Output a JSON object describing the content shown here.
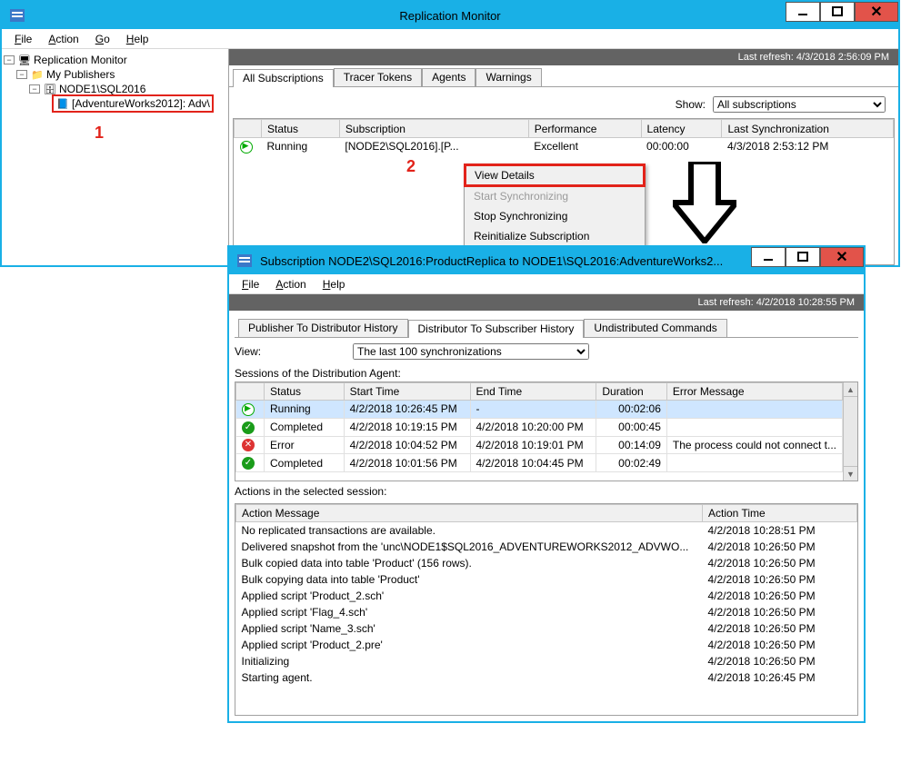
{
  "outer": {
    "title": "Replication Monitor",
    "menu": [
      "File",
      "Action",
      "Go",
      "Help"
    ],
    "last_refresh": "Last refresh: 4/3/2018 2:56:09 PM",
    "tree": {
      "root": "Replication Monitor",
      "publishers": "My Publishers",
      "node": "NODE1\\SQL2016",
      "pub": "[AdventureWorks2012]: Adv\\"
    },
    "tabs": [
      "All Subscriptions",
      "Tracer Tokens",
      "Agents",
      "Warnings"
    ],
    "show_label": "Show:",
    "show_value": "All subscriptions",
    "grid": {
      "headers": [
        "Status",
        "Subscription",
        "Performance",
        "Latency",
        "Last Synchronization"
      ],
      "row": {
        "status": "Running",
        "subscription": "[NODE2\\SQL2016].[P...",
        "performance": "Excellent",
        "latency": "00:00:00",
        "last_sync": "4/3/2018 2:53:12 PM"
      }
    },
    "ctx": {
      "view_details": "View Details",
      "start": "Start Synchronizing",
      "stop": "Stop Synchronizing",
      "reinit": "Reinitialize Subscription"
    },
    "ann1": "1",
    "ann2": "2"
  },
  "inner": {
    "title": "Subscription NODE2\\SQL2016:ProductReplica to NODE1\\SQL2016:AdventureWorks2...",
    "menu": [
      "File",
      "Action",
      "Help"
    ],
    "last_refresh": "Last refresh: 4/2/2018 10:28:55 PM",
    "tabs": [
      "Publisher To Distributor History",
      "Distributor To Subscriber History",
      "Undistributed Commands"
    ],
    "view_label": "View:",
    "view_value": "The last 100 synchronizations",
    "sessions_label": "Sessions of the Distribution Agent:",
    "sessions_headers": [
      "Status",
      "Start Time",
      "End Time",
      "Duration",
      "Error Message"
    ],
    "sessions": [
      {
        "icon": "run",
        "status": "Running",
        "start": "4/2/2018 10:26:45 PM",
        "end": "-",
        "duration": "00:02:06",
        "err": ""
      },
      {
        "icon": "ok",
        "status": "Completed",
        "start": "4/2/2018 10:19:15 PM",
        "end": "4/2/2018 10:20:00 PM",
        "duration": "00:00:45",
        "err": ""
      },
      {
        "icon": "err",
        "status": "Error",
        "start": "4/2/2018 10:04:52 PM",
        "end": "4/2/2018 10:19:01 PM",
        "duration": "00:14:09",
        "err": "The process could not connect t..."
      },
      {
        "icon": "ok",
        "status": "Completed",
        "start": "4/2/2018 10:01:56 PM",
        "end": "4/2/2018 10:04:45 PM",
        "duration": "00:02:49",
        "err": ""
      }
    ],
    "actions_label": "Actions in the selected session:",
    "actions_headers": [
      "Action Message",
      "Action Time"
    ],
    "actions": [
      {
        "msg": "No replicated transactions are available.",
        "time": "4/2/2018 10:28:51 PM"
      },
      {
        "msg": "Delivered snapshot from the 'unc\\NODE1$SQL2016_ADVENTUREWORKS2012_ADVWO...",
        "time": "4/2/2018 10:26:50 PM"
      },
      {
        "msg": "Bulk copied data into table 'Product' (156 rows).",
        "time": "4/2/2018 10:26:50 PM"
      },
      {
        "msg": "Bulk copying data into table 'Product'",
        "time": "4/2/2018 10:26:50 PM"
      },
      {
        "msg": "Applied script 'Product_2.sch'",
        "time": "4/2/2018 10:26:50 PM"
      },
      {
        "msg": "Applied script 'Flag_4.sch'",
        "time": "4/2/2018 10:26:50 PM"
      },
      {
        "msg": "Applied script 'Name_3.sch'",
        "time": "4/2/2018 10:26:50 PM"
      },
      {
        "msg": "Applied script 'Product_2.pre'",
        "time": "4/2/2018 10:26:50 PM"
      },
      {
        "msg": "Initializing",
        "time": "4/2/2018 10:26:50 PM"
      },
      {
        "msg": "Starting agent.",
        "time": "4/2/2018 10:26:45 PM"
      }
    ]
  }
}
